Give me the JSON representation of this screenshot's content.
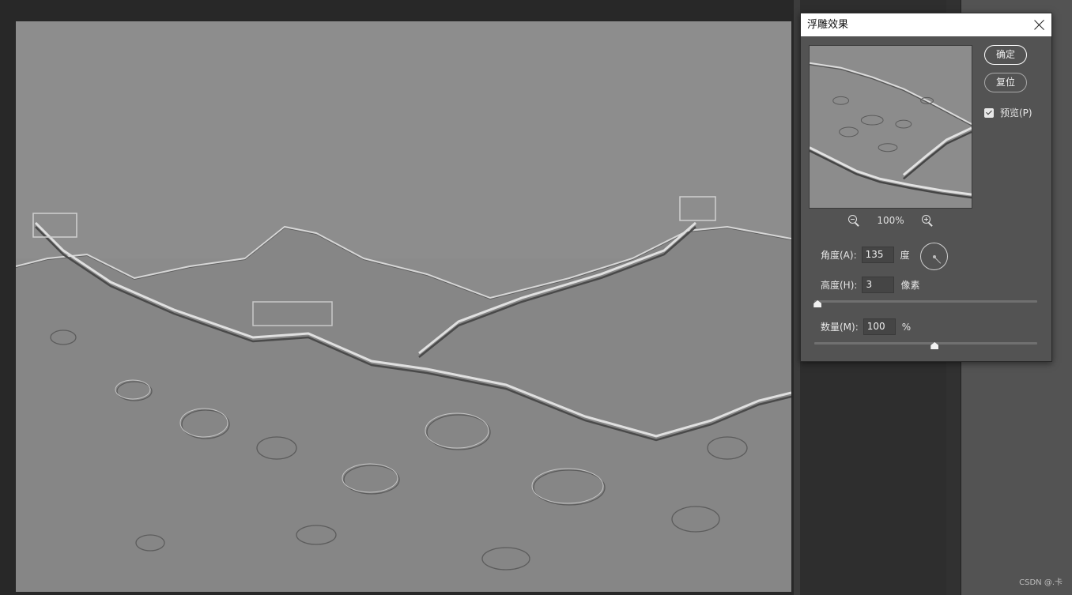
{
  "dialog": {
    "title": "浮雕效果",
    "ok_label": "确定",
    "reset_label": "复位",
    "preview_label": "预览(P)",
    "preview_checked": true,
    "zoom_level": "100%",
    "angle": {
      "label": "角度(A):",
      "value": "135",
      "unit": "度"
    },
    "height": {
      "label": "高度(H):",
      "value": "3",
      "unit": "像素",
      "slider_percent": 1.5
    },
    "amount": {
      "label": "数量(M):",
      "value": "100",
      "unit": "%",
      "slider_percent": 54
    }
  },
  "watermark": "CSDN @.卡",
  "icons": [
    "close-icon",
    "zoom-out-icon",
    "zoom-in-icon",
    "angle-dial-icon",
    "checkbox-checked-icon"
  ]
}
